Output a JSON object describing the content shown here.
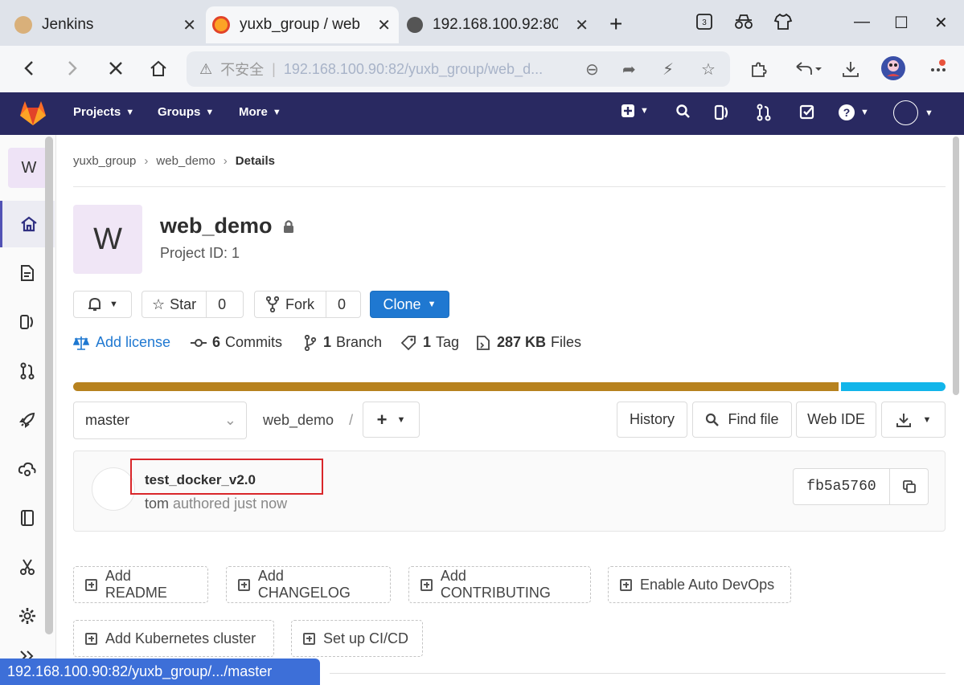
{
  "browser": {
    "tabs": [
      {
        "title": "Jenkins"
      },
      {
        "title": "yuxb_group / web"
      },
      {
        "title": "192.168.100.92:80"
      }
    ],
    "new_tab": "+",
    "tab_count_badge": "3",
    "address": {
      "security_label": "不安全",
      "url": "192.168.100.90:82/yuxb_group/web_d..."
    }
  },
  "gitlab_nav": {
    "menus": [
      "Projects",
      "Groups",
      "More"
    ]
  },
  "sidebar": {
    "project_letter": "W",
    "items": [
      "home-icon",
      "repository-icon",
      "issues-icon",
      "merge-requests-icon",
      "ci-cd-icon",
      "operations-icon",
      "wiki-icon",
      "snippets-icon",
      "settings-icon",
      "collapse-icon"
    ]
  },
  "breadcrumb": {
    "group": "yuxb_group",
    "project": "web_demo",
    "current": "Details"
  },
  "project": {
    "avatar_letter": "W",
    "name": "web_demo",
    "id_label": "Project ID: 1"
  },
  "actions": {
    "star_label": "Star",
    "star_count": "0",
    "fork_label": "Fork",
    "fork_count": "0",
    "clone_label": "Clone"
  },
  "stats": {
    "license": "Add license",
    "commits_count": "6",
    "commits_label": "Commits",
    "branch_count": "1",
    "branch_label": "Branch",
    "tag_count": "1",
    "tag_label": "Tag",
    "files_size": "287 KB",
    "files_label": "Files"
  },
  "languages": [
    {
      "share": 0.88,
      "color": "#b7821f"
    },
    {
      "share": 0.12,
      "color": "#12b5ea"
    }
  ],
  "repo_controls": {
    "branch": "master",
    "path": "web_demo",
    "path_sep": "/",
    "history": "History",
    "find_file": "Find file",
    "web_ide": "Web IDE"
  },
  "last_commit": {
    "title": "test_docker_v2.0",
    "author": "tom",
    "meta": "authored just now",
    "sha": "fb5a5760"
  },
  "quick_actions": [
    "Add README",
    "Add CHANGELOG",
    "Add CONTRIBUTING",
    "Enable Auto DevOps",
    "Add Kubernetes cluster",
    "Set up CI/CD"
  ],
  "status_bar": {
    "url": "192.168.100.90:82/yuxb_group/.../master"
  }
}
